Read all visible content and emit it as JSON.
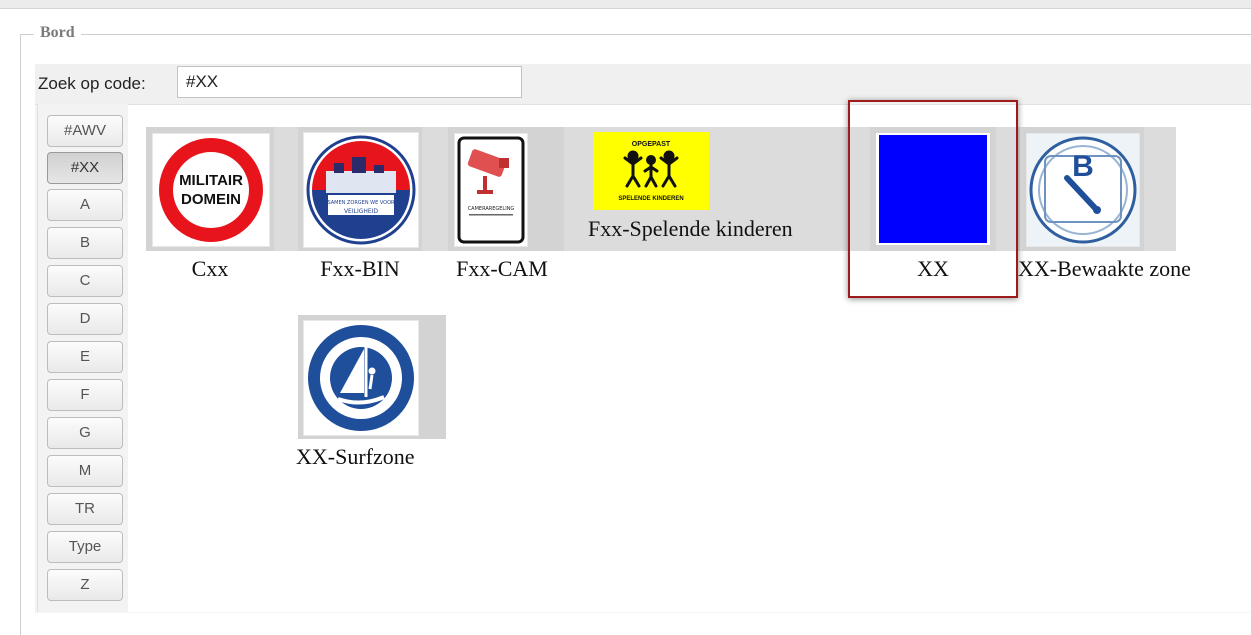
{
  "fieldset": {
    "legend": "Bord"
  },
  "search": {
    "label": "Zoek op code:",
    "value": "#XX"
  },
  "tabs": [
    "#AWV",
    "#XX",
    "A",
    "B",
    "C",
    "D",
    "E",
    "F",
    "G",
    "M",
    "TR",
    "Type",
    "Z"
  ],
  "active_tab": "#XX",
  "signs": [
    {
      "caption": "Cxx",
      "icon": "militair-domein-sign-icon",
      "sign_text": [
        "MILITAIR",
        "DOMEIN"
      ]
    },
    {
      "caption": "Fxx-BIN",
      "icon": "bin-neighborhood-watch-sign-icon",
      "sign_text": [
        "SAMEN ZORGEN WE VOOR",
        "VEILIGHEID"
      ]
    },
    {
      "caption": "Fxx-CAM",
      "icon": "camera-surveillance-sign-icon",
      "sign_text": [
        "CAMERAREGELING"
      ]
    },
    {
      "caption": "Fxx-Spelende kinderen",
      "icon": "playing-children-sign-icon",
      "sign_text": [
        "OPGEPAST",
        "SPELENDE KINDEREN"
      ]
    },
    {
      "caption": "XX",
      "icon": "blue-square-sign-icon",
      "color": "#0000ff",
      "selected": true
    },
    {
      "caption": "XX-Bewaakte zone",
      "icon": "guarded-zone-sign-icon",
      "sign_text": [
        "B"
      ]
    },
    {
      "caption": "XX-Surfzone",
      "icon": "surf-zone-sign-icon"
    }
  ],
  "colors": {
    "selection_border": "#9e1b1b",
    "thumbnail_bg": "#d3d3d3",
    "sign_red": "#e8141b",
    "sign_blue": "#1f4e9a",
    "sign_yellow": "#ffff00"
  }
}
